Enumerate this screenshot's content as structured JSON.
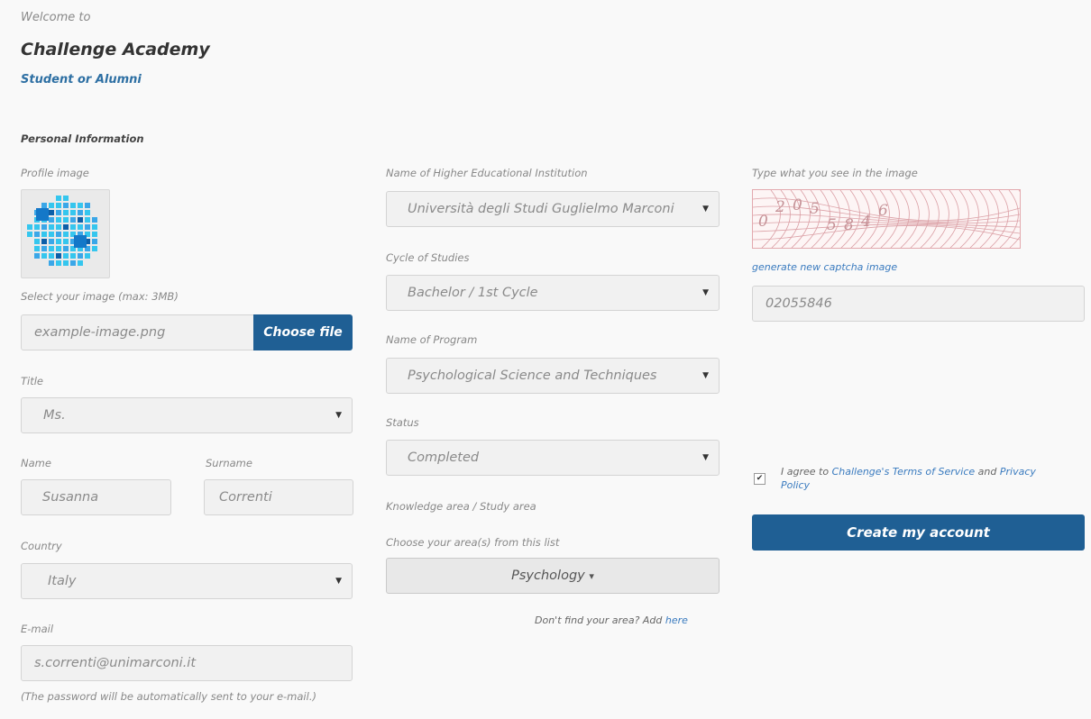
{
  "header": {
    "welcome": "Welcome to",
    "academy": "Challenge Academy",
    "role": "Student or Alumni"
  },
  "section": {
    "personal": "Personal Information"
  },
  "profile": {
    "label": "Profile image",
    "select_label": "Select your image (max: 3MB)",
    "file_value": "example-image.png",
    "choose_file": "Choose file"
  },
  "title": {
    "label": "Title",
    "value": "Ms."
  },
  "name": {
    "label": "Name",
    "value": "Susanna"
  },
  "surname": {
    "label": "Surname",
    "value": "Correnti"
  },
  "country": {
    "label": "Country",
    "value": "Italy"
  },
  "email": {
    "label": "E-mail",
    "value": "s.correnti@unimarconi.it"
  },
  "password_note": "(The password will be automatically sent to your e-mail.)",
  "institution": {
    "label": "Name of Higher Educational Institution",
    "value": "Università degli Studi Guglielmo Marconi"
  },
  "cycle": {
    "label": "Cycle of Studies",
    "value": "Bachelor / 1st Cycle"
  },
  "program": {
    "label": "Name of Program",
    "value": "Psychological Science and Techniques"
  },
  "status": {
    "label": "Status",
    "value": "Completed"
  },
  "knowledge": {
    "label": "Knowledge area / Study area",
    "choose_label": "Choose your area(s) from this list",
    "selected": "Psychology",
    "find_text": "Don't find your area? Add",
    "find_link": "here"
  },
  "captcha": {
    "label": "Type what you see in the image",
    "image_text": "02055846",
    "generate_link": "generate new captcha image",
    "value": "02055846"
  },
  "terms": {
    "prefix": "I agree to",
    "tos_link": "Challenge's Terms of Service",
    "and": "and",
    "privacy_link": "Privacy Policy",
    "checked": true
  },
  "create_button": "Create my account",
  "icons": {
    "caret": "▼",
    "dropdown_caret": "▾",
    "check": "✔"
  },
  "colors": {
    "primary": "#1f5f94",
    "link": "#3a7bbf",
    "captcha_border": "#e3a9ae"
  }
}
